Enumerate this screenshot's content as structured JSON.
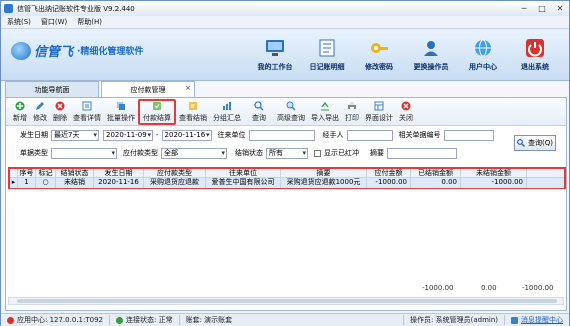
{
  "window": {
    "title": "信管飞出纳记账软件专业版 V9.2.440",
    "min": "─",
    "max": "□",
    "close": "✕"
  },
  "menu": [
    "系统(S)",
    "窗口(W)",
    "帮助(H)"
  ],
  "banner": {
    "logo_name": "信管飞",
    "slogan": "·精细化管理软件",
    "actions": [
      {
        "label": "我的工作台",
        "icon": "desktop-icon"
      },
      {
        "label": "日记账明细",
        "icon": "ledger-icon"
      },
      {
        "label": "修改密码",
        "icon": "key-icon"
      },
      {
        "label": "更换操作员",
        "icon": "user-switch-icon"
      },
      {
        "label": "用户中心",
        "icon": "globe-icon"
      },
      {
        "label": "退出系统",
        "icon": "power-icon"
      }
    ]
  },
  "tabs": [
    {
      "label": "功能导航面",
      "active": false
    },
    {
      "label": "应付款管理",
      "active": true
    }
  ],
  "toolbar": [
    {
      "label": "新增",
      "icon": "add-icon",
      "dropdown": true
    },
    {
      "label": "修改",
      "icon": "edit-icon"
    },
    {
      "label": "删除",
      "icon": "delete-icon"
    },
    {
      "label": "查看详情",
      "icon": "details-icon"
    },
    {
      "label": "批量操作",
      "icon": "batch-icon"
    },
    {
      "label": "付款结算",
      "icon": "payment-settle-icon",
      "highlight": true
    },
    {
      "label": "查看结销",
      "icon": "view-settle-icon"
    },
    {
      "label": "分组汇总",
      "icon": "group-summary-icon",
      "dropdown": true
    },
    {
      "label": "查询",
      "icon": "query-icon",
      "dropdown": true
    },
    {
      "label": "高级查询",
      "icon": "advanced-query-icon"
    },
    {
      "label": "导入导出",
      "icon": "import-export-icon",
      "dropdown": true
    },
    {
      "label": "打印",
      "icon": "print-icon",
      "dropdown": true
    },
    {
      "label": "界面设计",
      "icon": "layout-design-icon"
    },
    {
      "label": "关闭",
      "icon": "close-circle-icon",
      "dropdown": true
    }
  ],
  "filters": {
    "date_label": "发生日期",
    "date_range": "最近7天",
    "date_from": "2020-11-09",
    "date_to": "2020-11-16",
    "counterparty_label": "往来单位",
    "handler_label": "经手人",
    "related_no_label": "相关单据编号",
    "doc_type_label": "单据类型",
    "pay_type_label": "应付款类型",
    "pay_type_value": "全部",
    "settle_status_label": "结销状态",
    "settle_status_value": "所有",
    "show_red_label": "显示已红冲",
    "summary_label": "摘要",
    "query_button": "查询(Q)"
  },
  "grid": {
    "headers": [
      "序号",
      "标记",
      "结销状态",
      "发生日期",
      "应付款类型",
      "往来单位",
      "摘要",
      "应付金额",
      "已结销金额",
      "未结销金额"
    ],
    "rows": [
      [
        "1",
        "",
        "未结销",
        "2020-11-16",
        "采购退货应退款",
        "爱普生中国有限公司",
        "采购退货应退款1000元",
        "-1000.00",
        "0.00",
        "-1000.00"
      ]
    ],
    "totals": {
      "due": "-1000.00",
      "settled": "0.00",
      "unsettled": "-1000.00"
    }
  },
  "status": {
    "app_center": "应用中心: 127.0.0.1:T092",
    "connection": "连接状态: 正常",
    "account": "账套: 演示账套",
    "operator": "操作员: 系统管理员(admin)",
    "messages": "消息提醒中心"
  },
  "colors": {
    "accent": "#1a6cc6",
    "highlight": "#e23b3b",
    "row_selected": "#dbe9fb"
  }
}
